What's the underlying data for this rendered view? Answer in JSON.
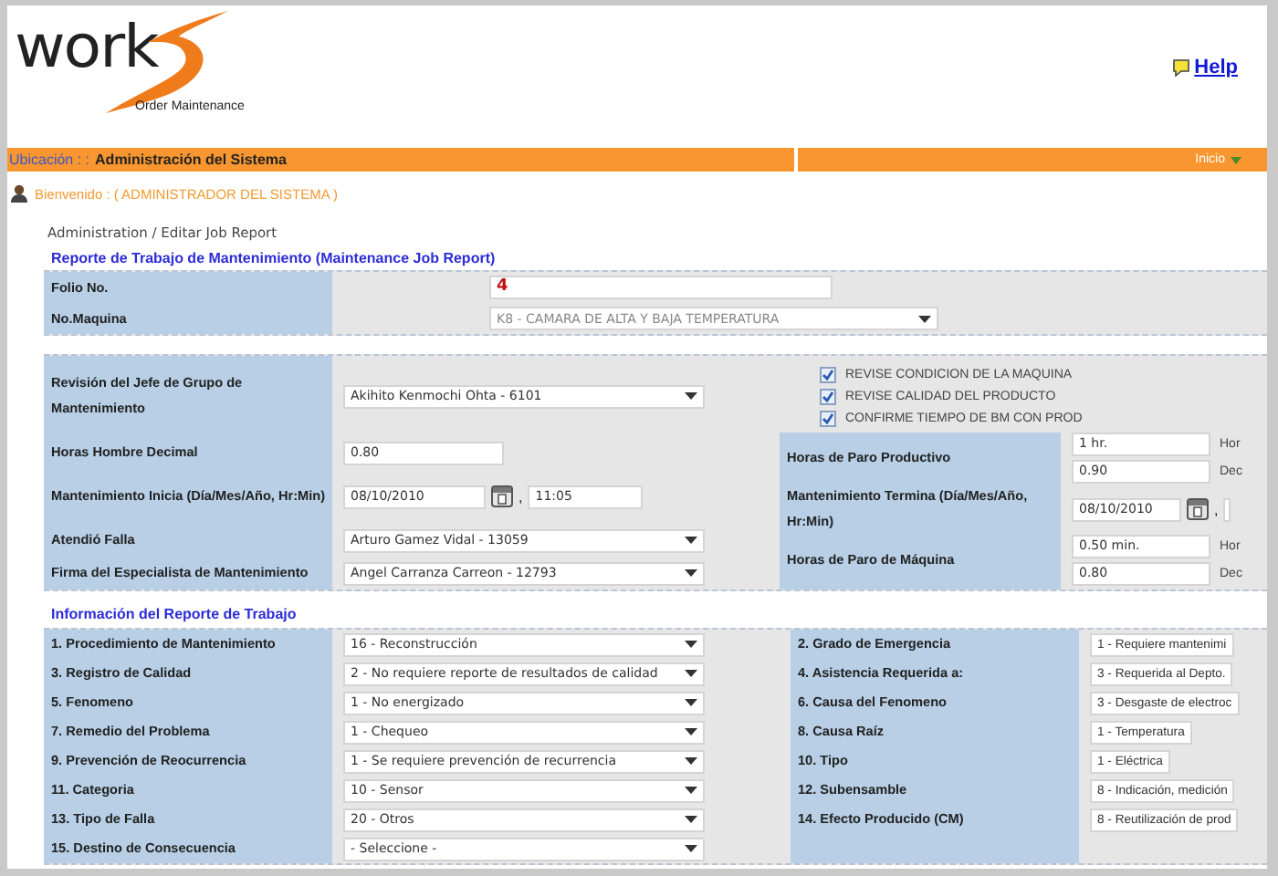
{
  "header": {
    "logo_text": "work",
    "tagline": "Order Maintenance",
    "help": "Help"
  },
  "location_bar": {
    "label": "Ubicación : :",
    "value": "Administración del Sistema",
    "menu": "Inicio"
  },
  "welcome": "Bienvenido : ( ADMINISTRADOR DEL SISTEMA )",
  "breadcrumb": "Administration / Editar Job Report",
  "section_1": {
    "title": "Reporte de Trabajo de Mantenimiento (Maintenance Job Report)",
    "fields": [
      {
        "label": "Folio No.",
        "kind": "text",
        "value": "4"
      },
      {
        "label": "No.Maquina",
        "kind": "select",
        "value": "K8 - CAMARA DE ALTA Y BAJA TEMPERATURA",
        "disabled": true
      }
    ]
  },
  "section_2": {
    "left_fields": [
      {
        "label": "Revisión del Jefe de Grupo de Mantenimiento",
        "kind": "select",
        "value": "Akihito Kenmochi Ohta - 6101"
      },
      {
        "label": "Horas Hombre Decimal",
        "kind": "text",
        "value": "0.80"
      },
      {
        "label": "Mantenimiento Inicia (Día/Mes/Año, Hr:Min)",
        "kind": "datetime",
        "date": "08/10/2010",
        "separator": ",",
        "time": "11:05"
      },
      {
        "label": "Atendió Falla",
        "kind": "select",
        "value": "Arturo Gamez Vidal - 13059"
      },
      {
        "label": "Firma del Especialista de Mantenimiento",
        "kind": "select",
        "value": "Angel Carranza Carreon - 12793"
      }
    ],
    "checkboxes": [
      {
        "label": "REVISE CONDICION DE LA MAQUINA",
        "checked": true
      },
      {
        "label": "REVISE CALIDAD DEL PRODUCTO",
        "checked": true
      },
      {
        "label": "CONFIRME TIEMPO DE BM CON PROD",
        "checked": true
      }
    ],
    "right_fields": [
      {
        "label": "Horas de Paro Productivo",
        "kind": "dual",
        "inputs": [
          {
            "value": "1 hr.",
            "unit": "Hor"
          },
          {
            "value": "0.90",
            "unit": "Dec"
          }
        ]
      },
      {
        "label": "Mantenimiento Termina (Día/Mes/Año, Hr:Min)",
        "kind": "datetime",
        "date": "08/10/2010",
        "separator": ","
      },
      {
        "label": "Horas de Paro de Máquina",
        "kind": "dual",
        "inputs": [
          {
            "value": "0.50 min.",
            "unit": "Hor"
          },
          {
            "value": "0.80",
            "unit": "Dec"
          }
        ]
      }
    ]
  },
  "section_3": {
    "title": "Información del Reporte de Trabajo",
    "rows": [
      {
        "left": {
          "label": "1. Procedimiento de Mantenimiento",
          "value": "16 - Reconstrucción"
        },
        "right": {
          "label": "2. Grado de Emergencia",
          "value": "1 - Requiere mantenimi"
        }
      },
      {
        "left": {
          "label": "3. Registro de Calidad",
          "value": "2 - No requiere reporte de resultados de calidad"
        },
        "right": {
          "label": "4. Asistencia Requerida a:",
          "value": "3 - Requerida al Depto."
        }
      },
      {
        "left": {
          "label": "5. Fenomeno",
          "value": "1 - No energizado"
        },
        "right": {
          "label": "6. Causa del Fenomeno",
          "value": "3 - Desgaste de electroc"
        }
      },
      {
        "left": {
          "label": "7. Remedio del Problema",
          "value": "1 - Chequeo"
        },
        "right": {
          "label": "8. Causa Raíz",
          "value": "1 - Temperatura"
        }
      },
      {
        "left": {
          "label": "9. Prevención de Reocurrencia",
          "value": "1 - Se requiere prevención de recurrencia"
        },
        "right": {
          "label": "10. Tipo",
          "value": "1 - Eléctrica"
        }
      },
      {
        "left": {
          "label": "11. Categoria",
          "value": "10 - Sensor"
        },
        "right": {
          "label": "12. Subensamble",
          "value": "8 - Indicación, medición"
        }
      },
      {
        "left": {
          "label": "13. Tipo de Falla",
          "value": "20 - Otros"
        },
        "right": {
          "label": "14. Efecto Producido (CM)",
          "value": "8 - Reutilización de prod"
        }
      },
      {
        "left": {
          "label": "15. Destino de Consecuencia",
          "value": "- Seleccione -"
        }
      }
    ]
  }
}
